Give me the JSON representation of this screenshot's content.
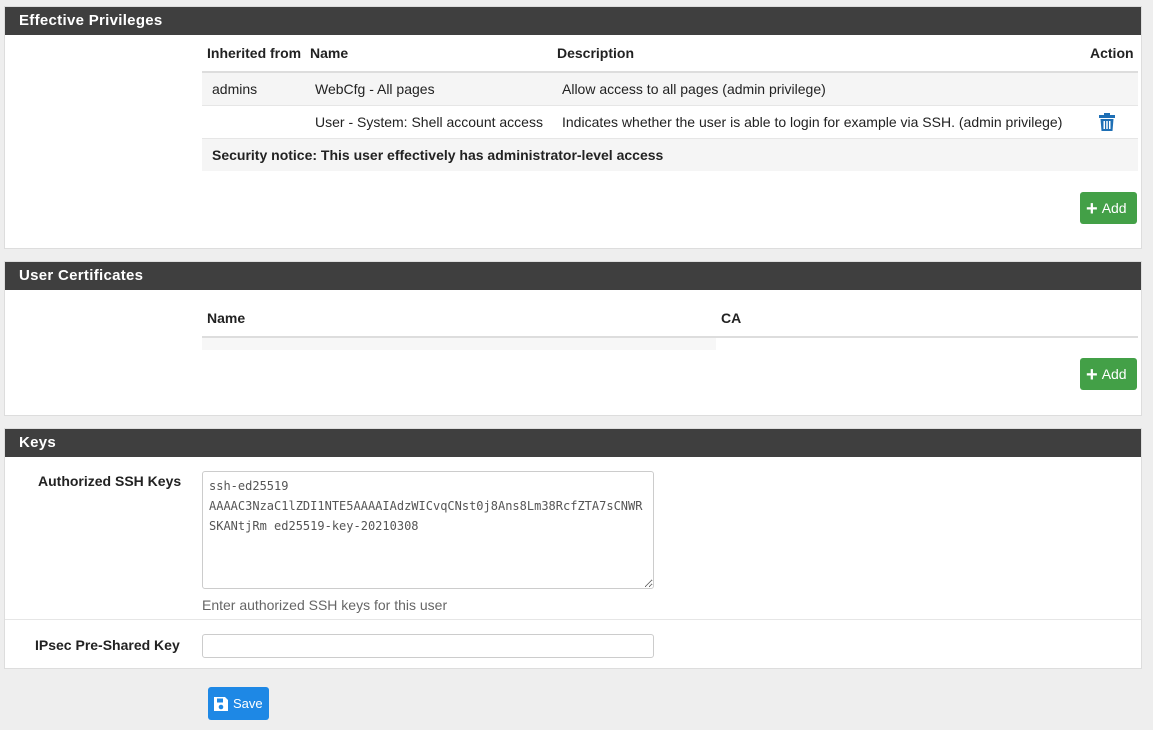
{
  "effective_privileges": {
    "title": "Effective Privileges",
    "columns": [
      "Inherited from",
      "Name",
      "Description",
      "Action"
    ],
    "rows": [
      {
        "inherited_from": "admins",
        "name": "WebCfg - All pages",
        "description": "Allow access to all pages (admin privilege)"
      },
      {
        "inherited_from": "",
        "name": "User - System: Shell account access",
        "description": "Indicates whether the user is able to login for example via SSH. (admin privilege)"
      }
    ],
    "security_notice": "Security notice: This user effectively has administrator-level access",
    "add_label": "Add"
  },
  "user_certificates": {
    "title": "User Certificates",
    "columns": [
      "Name",
      "CA"
    ],
    "add_label": "Add"
  },
  "keys": {
    "title": "Keys",
    "ssh_label": "Authorized SSH Keys",
    "ssh_value": "ssh-ed25519 AAAAC3NzaC1lZDI1NTE5AAAAIAdzWICvqCNst0j8Ans8Lm38RcfZTA7sCNWRSKANtjRm ed25519-key-20210308",
    "ssh_help": "Enter authorized SSH keys for this user",
    "ipsec_label": "IPsec Pre-Shared Key",
    "ipsec_value": ""
  },
  "save_label": "Save",
  "colors": {
    "header": "#3f3f3f",
    "add_button": "#43a047",
    "save_button": "#1e88e5",
    "trash_icon": "#1e6fb5"
  }
}
